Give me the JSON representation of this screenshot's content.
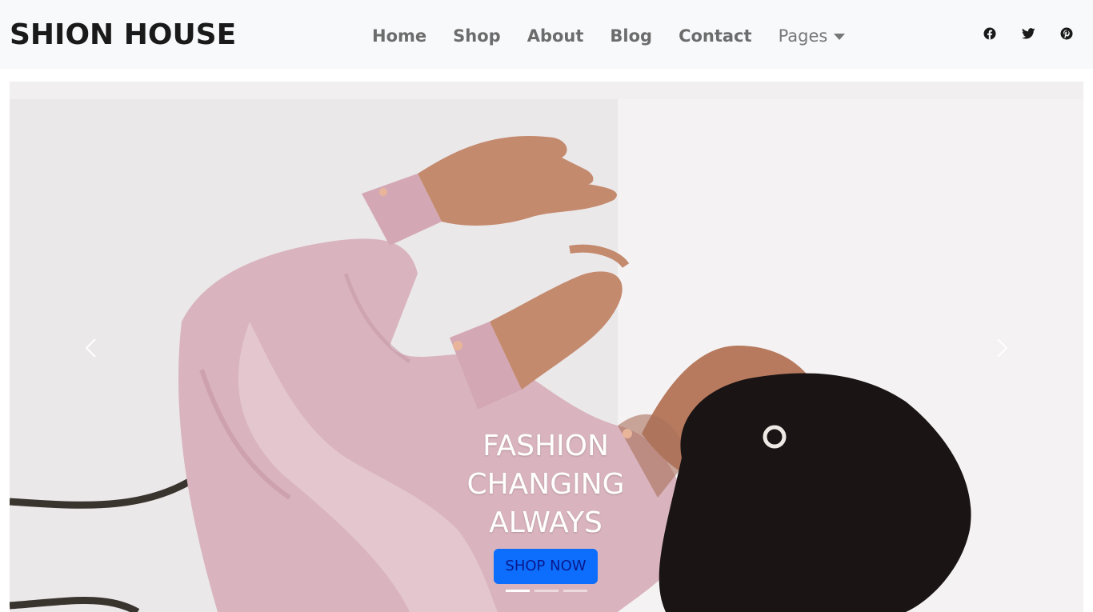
{
  "brand": {
    "title": "SHION HOUSE"
  },
  "nav": {
    "items": [
      {
        "label": "Home"
      },
      {
        "label": "Shop"
      },
      {
        "label": "About"
      },
      {
        "label": "Blog"
      },
      {
        "label": "Contact"
      },
      {
        "label": "Pages"
      }
    ]
  },
  "socials": [
    {
      "icon": "facebook-icon"
    },
    {
      "icon": "twitter-icon"
    },
    {
      "icon": "pinterest-icon"
    }
  ],
  "hero": {
    "title_lines": [
      "FASHION",
      "CHANGING",
      "ALWAYS"
    ],
    "button_label": "SHOP NOW",
    "slide_count": 3,
    "active_slide": 1
  },
  "colors": {
    "navbar_bg": "#f8f9fa",
    "brand_text": "#1a1a1a",
    "nav_text": "#6c6c6c",
    "button_bg": "#0d6efd",
    "button_text": "#0a1a8c",
    "shirt": "#d9b3bd",
    "hair": "#1a1414",
    "skin": "#c48a6e"
  }
}
